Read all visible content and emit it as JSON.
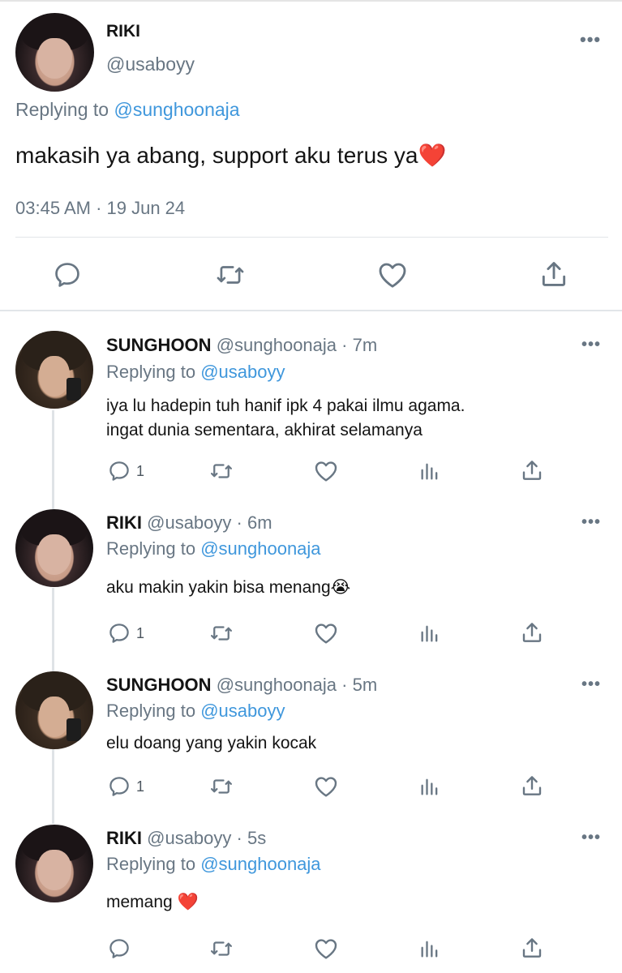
{
  "main_tweet": {
    "name": "RIKI",
    "handle": "@usaboyy",
    "replying_prefix": "Replying to",
    "replying_to": "@sunghoonaja",
    "text": "makasih ya abang, support aku terus ya",
    "text_emoji": "❤️",
    "timestamp": "03:45 AM · 19 Jun 24",
    "more": "•••"
  },
  "replies": [
    {
      "name": "SUNGHOON",
      "handle": "@sunghoonaja",
      "time": "· 7m",
      "replying_prefix": "Replying to",
      "replying_to": "@usaboyy",
      "line1": "iya lu hadepin tuh hanif ipk 4 pakai ilmu agama.",
      "line2": "ingat dunia sementara, akhirat selamanya",
      "reply_count": "1",
      "more": "•••"
    },
    {
      "name": "RIKI",
      "handle": "@usaboyy",
      "time": "· 6m",
      "replying_prefix": "Replying to",
      "replying_to": "@sunghoonaja",
      "line1": "aku makin yakin bisa menang",
      "emoji": "😭",
      "reply_count": "1",
      "more": "•••"
    },
    {
      "name": "SUNGHOON",
      "handle": "@sunghoonaja",
      "time": "· 5m",
      "replying_prefix": "Replying to",
      "replying_to": "@usaboyy",
      "line1": "elu doang yang yakin kocak",
      "reply_count": "1",
      "more": "•••"
    },
    {
      "name": "RIKI",
      "handle": "@usaboyy",
      "time": "· 5s",
      "replying_prefix": "Replying to",
      "replying_to": "@sunghoonaja",
      "line1": "memang",
      "emoji": "❤️",
      "more": "•••"
    }
  ],
  "colors": {
    "link": "#3f97dc",
    "secondary_text": "#687683",
    "divider": "#e2e6e9"
  }
}
